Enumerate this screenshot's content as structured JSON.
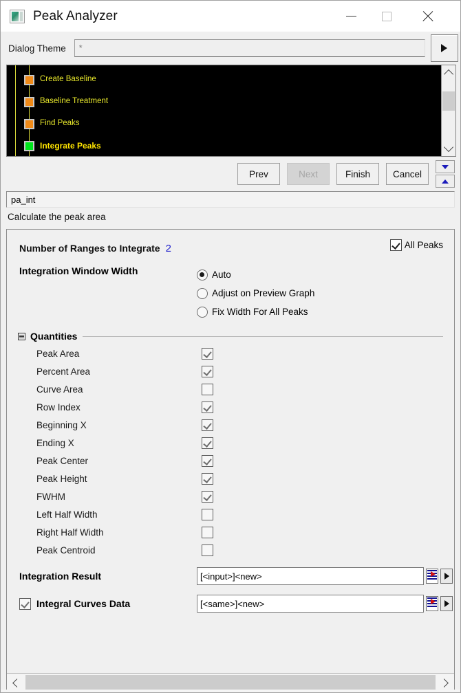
{
  "window": {
    "title": "Peak Analyzer",
    "icon": "app-window-icon",
    "minimize": "—",
    "maximize": "□",
    "close": "✕"
  },
  "theme": {
    "label": "Dialog Theme",
    "value": "*",
    "arrow_icon": "triangle-right-icon"
  },
  "tree": {
    "nodes": [
      {
        "label": "Create Baseline",
        "state": "done",
        "color": "#f08a18"
      },
      {
        "label": "Baseline Treatment",
        "state": "done",
        "color": "#f08a18"
      },
      {
        "label": "Find Peaks",
        "state": "done",
        "color": "#f08a18"
      },
      {
        "label": "Integrate Peaks",
        "state": "current",
        "color": "#00e61c"
      }
    ],
    "scroll_up_icon": "chevron-up-icon",
    "scroll_down_icon": "chevron-down-icon"
  },
  "nav": {
    "prev": "Prev",
    "next": "Next",
    "next_disabled": true,
    "finish": "Finish",
    "cancel": "Cancel",
    "spin_down_icon": "triangle-down-icon",
    "spin_up_icon": "triangle-up-icon"
  },
  "info": {
    "name": "pa_int",
    "description": "Calculate the peak area"
  },
  "settings": {
    "ranges_label": "Number of Ranges to Integrate",
    "ranges_value": "2",
    "ranges_value_color": "#2222cc",
    "all_peaks_label": "All Peaks",
    "all_peaks_checked": true,
    "window_width_label": "Integration Window Width",
    "window_width_options": [
      {
        "label": "Auto",
        "selected": true
      },
      {
        "label": "Adjust on Preview Graph",
        "selected": false
      },
      {
        "label": "Fix Width For All Peaks",
        "selected": false
      }
    ]
  },
  "quantities": {
    "title": "Quantities",
    "collapse_icon": "collapse-box-icon",
    "items": [
      {
        "label": "Peak Area",
        "checked": true
      },
      {
        "label": "Percent Area",
        "checked": true
      },
      {
        "label": "Curve Area",
        "checked": false
      },
      {
        "label": "Row Index",
        "checked": true
      },
      {
        "label": "Beginning X",
        "checked": true
      },
      {
        "label": "Ending X",
        "checked": true
      },
      {
        "label": "Peak Center",
        "checked": true
      },
      {
        "label": "Peak Height",
        "checked": true
      },
      {
        "label": "FWHM",
        "checked": true
      },
      {
        "label": "Left Half Width",
        "checked": false
      },
      {
        "label": "Right Half Width",
        "checked": false
      },
      {
        "label": "Peak Centroid",
        "checked": false
      }
    ]
  },
  "results": {
    "integration_result": {
      "label": "Integration Result",
      "value": "[<input>]<new>",
      "sheet_icon": "worksheet-icon",
      "arrow_icon": "triangle-right-icon"
    },
    "integral_curves": {
      "label": "Integral Curves Data",
      "checked": true,
      "value": "[<same>]<new>",
      "sheet_icon": "worksheet-icon",
      "arrow_icon": "triangle-right-icon"
    }
  },
  "hscroll": {
    "left_icon": "chevron-left-icon",
    "right_icon": "chevron-right-icon"
  }
}
